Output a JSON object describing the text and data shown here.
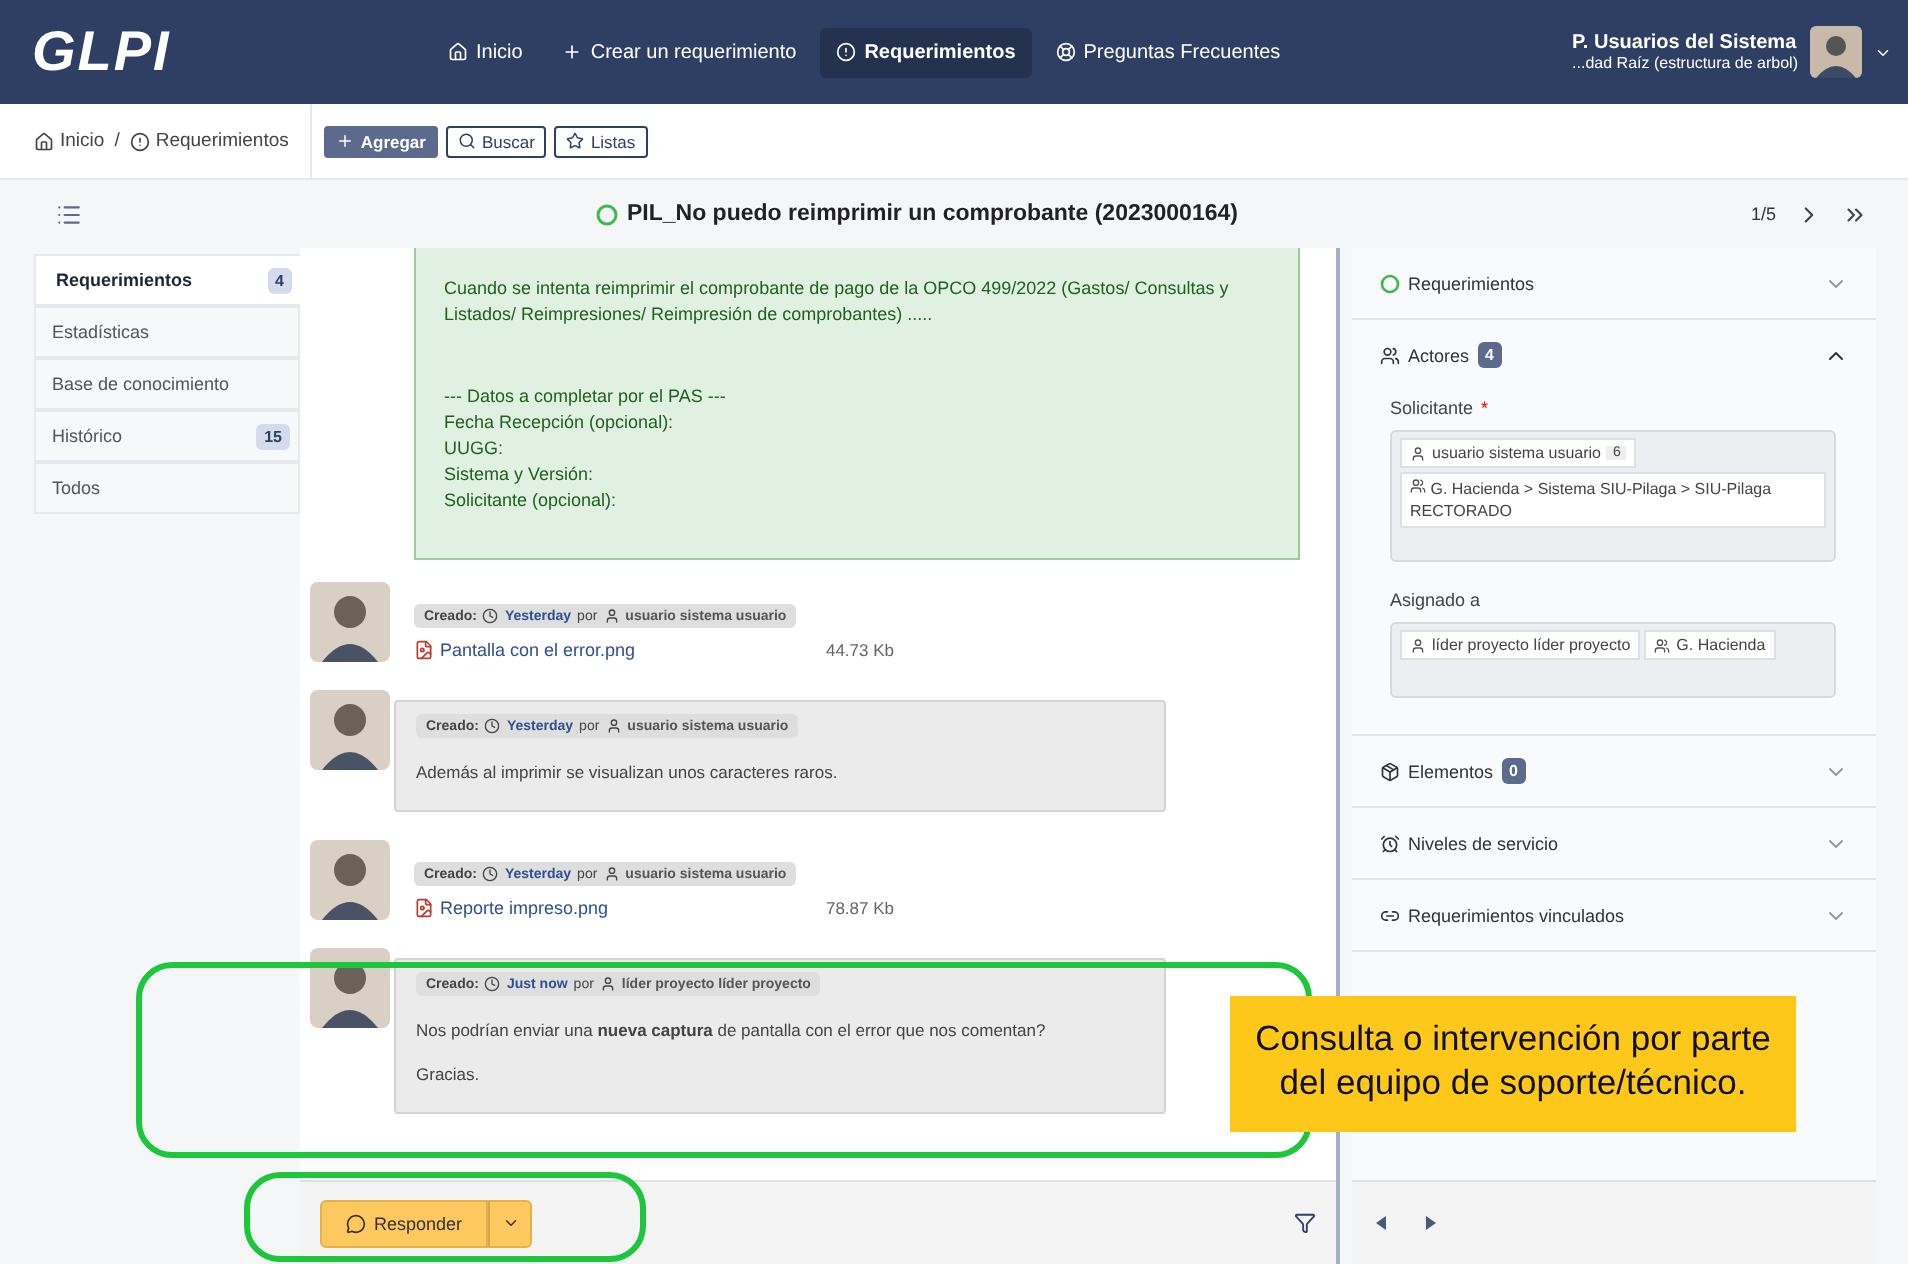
{
  "header": {
    "logo": "GLPI",
    "nav": [
      {
        "label": "Inicio",
        "selected": false
      },
      {
        "label": "Crear un requerimiento",
        "selected": false
      },
      {
        "label": "Requerimientos",
        "selected": true
      },
      {
        "label": "Preguntas Frecuentes",
        "selected": false
      }
    ],
    "user": {
      "name": "P. Usuarios del Sistema",
      "entity": "...dad Raíz (estructura de arbol)"
    }
  },
  "breadcrumb": {
    "items": [
      "Inicio",
      "/",
      "Requerimientos"
    ],
    "actions": [
      {
        "label": "Agregar",
        "kind": "primary"
      },
      {
        "label": "Buscar",
        "kind": "outline"
      },
      {
        "label": "Listas",
        "kind": "outline"
      }
    ]
  },
  "ticket": {
    "title": "PIL_No puedo reimprimir un comprobante (2023000164)",
    "pager": "1/5"
  },
  "tabs": [
    {
      "label": "Requerimientos",
      "count": "4",
      "selected": true
    },
    {
      "label": "Estadísticas",
      "selected": false
    },
    {
      "label": "Base de conocimiento",
      "selected": false
    },
    {
      "label": "Histórico",
      "count": "15",
      "selected": false
    },
    {
      "label": "Todos",
      "selected": false
    }
  ],
  "description": [
    "Cuando se intenta reimprimir el comprobante de pago de la OPCO 499/2022 (Gastos/ Consultas y Listados/ Reimpresiones/ Reimpresión de comprobantes)  .....",
    "--- Datos a completar por el PAS ---",
    "Fecha Recepción (opcional):",
    "UUGG:",
    "Sistema y Versión:",
    "Solicitante (opcional):"
  ],
  "timeline": [
    {
      "kind": "document",
      "created": "Creado:",
      "time": "Yesterday",
      "by": "por",
      "author": "usuario sistema usuario",
      "file": "Pantalla con el error.png",
      "size": "44.73 Kb"
    },
    {
      "kind": "followup",
      "created": "Creado:",
      "time": "Yesterday",
      "by": "por",
      "author": "usuario sistema usuario",
      "text": [
        "Además al imprimir se visualizan unos caracteres raros."
      ]
    },
    {
      "kind": "document",
      "created": "Creado:",
      "time": "Yesterday",
      "by": "por",
      "author": "usuario sistema usuario",
      "file": "Reporte impreso.png",
      "size": "78.87 Kb"
    },
    {
      "kind": "followup",
      "created": "Creado:",
      "time": "Just now",
      "by": "por",
      "author": "líder proyecto líder proyecto",
      "text": [
        "Nos podrían enviar una **nueva captura** de pantalla con el error que nos comentan?",
        "Gracias."
      ]
    }
  ],
  "reply": {
    "label": "Responder"
  },
  "panel": {
    "sections": [
      {
        "label": "Requerimientos",
        "expanded": false
      },
      {
        "label": "Actores",
        "count": "4",
        "expanded": true
      },
      {
        "label": "Elementos",
        "count": "0",
        "expanded": false
      },
      {
        "label": "Niveles de servicio",
        "expanded": false
      },
      {
        "label": "Requerimientos vinculados",
        "expanded": false
      }
    ],
    "actors": [
      {
        "label": "Solicitante",
        "mark": "*",
        "chips": [
          {
            "kind": "user",
            "label": "usuario sistema usuario",
            "count": "6"
          },
          {
            "kind": "group",
            "label": "G. Hacienda > Sistema SIU-Pilaga > SIU-Pilaga RECTORADO"
          }
        ]
      },
      {
        "label": "Asignado a",
        "chips": [
          {
            "kind": "user",
            "label": "líder proyecto líder proyecto"
          },
          {
            "kind": "group",
            "label": "G. Hacienda"
          }
        ]
      }
    ]
  },
  "callout": "Consulta o intervención por parte del equipo de soporte/técnico."
}
